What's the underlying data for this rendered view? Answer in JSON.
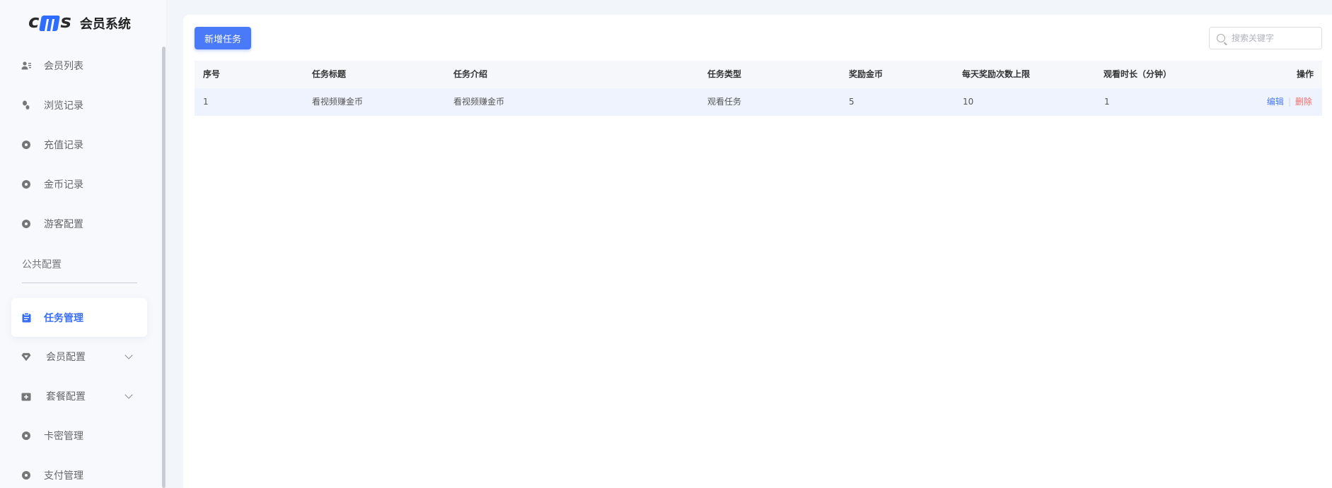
{
  "app": {
    "logo_text_c": "c",
    "logo_text_s": "s",
    "title": "会员系统"
  },
  "sidebar": {
    "items": [
      {
        "label": "会员列表",
        "icon": "user-list-icon"
      },
      {
        "label": "浏览记录",
        "icon": "footprint-icon"
      },
      {
        "label": "充值记录",
        "icon": "coin-icon"
      },
      {
        "label": "金币记录",
        "icon": "coin-icon"
      },
      {
        "label": "游客配置",
        "icon": "guest-icon"
      }
    ],
    "section_label": "公共配置",
    "group_items": [
      {
        "label": "任务管理",
        "icon": "clipboard-icon",
        "active": true
      },
      {
        "label": "会员配置",
        "icon": "diamond-icon",
        "expandable": true
      },
      {
        "label": "套餐配置",
        "icon": "package-icon",
        "expandable": true
      },
      {
        "label": "卡密管理",
        "icon": "key-icon"
      },
      {
        "label": "支付管理",
        "icon": "payment-icon"
      }
    ],
    "accent_color": "#3a6ff5"
  },
  "toolbar": {
    "add_label": "新增任务",
    "search_placeholder": "搜索关键字"
  },
  "table": {
    "columns": [
      "序号",
      "任务标题",
      "任务介绍",
      "任务类型",
      "奖励金币",
      "每天奖励次数上限",
      "观看时长（分钟）",
      "操作"
    ],
    "rows": [
      {
        "index": "1",
        "title": "看视频赚金币",
        "intro": "看视频赚金币",
        "type": "观看任务",
        "reward": "5",
        "daily_limit": "10",
        "duration": "1",
        "edit_label": "编辑",
        "delete_label": "删除"
      }
    ]
  }
}
